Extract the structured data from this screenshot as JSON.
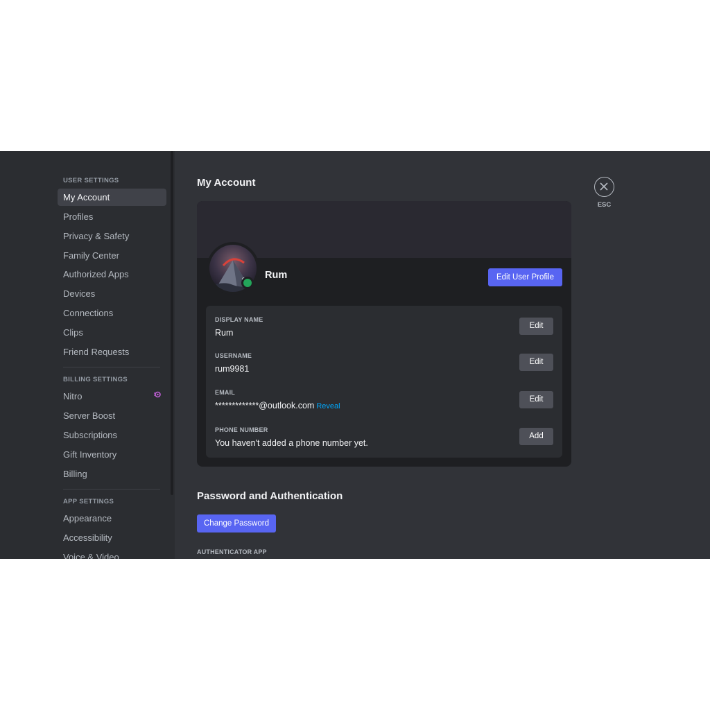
{
  "sidebar": {
    "user_settings_header": "USER SETTINGS",
    "user_items": [
      {
        "label": "My Account",
        "selected": true
      },
      {
        "label": "Profiles"
      },
      {
        "label": "Privacy & Safety"
      },
      {
        "label": "Family Center"
      },
      {
        "label": "Authorized Apps"
      },
      {
        "label": "Devices"
      },
      {
        "label": "Connections"
      },
      {
        "label": "Clips"
      },
      {
        "label": "Friend Requests"
      }
    ],
    "billing_settings_header": "BILLING SETTINGS",
    "billing_items": [
      {
        "label": "Nitro",
        "icon": "nitro-icon"
      },
      {
        "label": "Server Boost"
      },
      {
        "label": "Subscriptions"
      },
      {
        "label": "Gift Inventory"
      },
      {
        "label": "Billing"
      }
    ],
    "app_settings_header": "APP SETTINGS",
    "app_items": [
      {
        "label": "Appearance"
      },
      {
        "label": "Accessibility"
      },
      {
        "label": "Voice & Video"
      }
    ]
  },
  "main": {
    "title": "My Account",
    "profile": {
      "name": "Rum",
      "status": "online",
      "edit_profile_label": "Edit User Profile"
    },
    "fields": [
      {
        "label": "DISPLAY NAME",
        "value": "Rum",
        "button": "Edit"
      },
      {
        "label": "USERNAME",
        "value": "rum9981",
        "button": "Edit"
      },
      {
        "label": "EMAIL",
        "value": "*************@outlook.com",
        "reveal": "Reveal",
        "button": "Edit"
      },
      {
        "label": "PHONE NUMBER",
        "value": "You haven't added a phone number yet.",
        "button": "Add"
      }
    ],
    "password_section": {
      "title": "Password and Authentication",
      "change_password_label": "Change Password",
      "authenticator_label": "AUTHENTICATOR APP"
    }
  },
  "close": {
    "label": "ESC",
    "icon": "close-icon"
  },
  "colors": {
    "accent": "#5865f2",
    "online": "#23a55a",
    "link": "#00a8fc",
    "nitro": "#c05fd6"
  }
}
